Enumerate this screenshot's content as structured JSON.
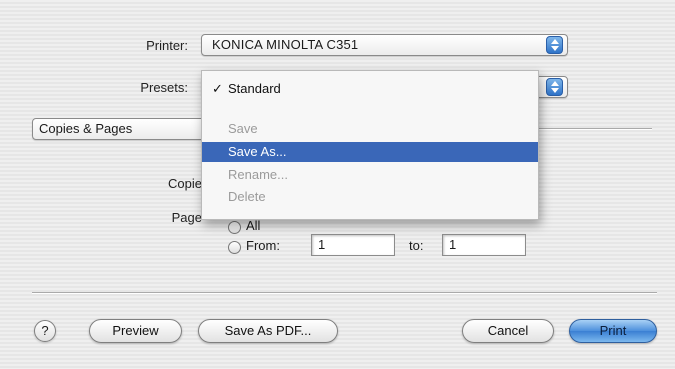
{
  "printer": {
    "label": "Printer:",
    "value": "KONICA MINOLTA C351"
  },
  "presets": {
    "label": "Presets:"
  },
  "section_popup": {
    "value": "Copies & Pages"
  },
  "presets_menu": {
    "items": [
      {
        "label": "Standard",
        "checked": true,
        "state": "normal"
      },
      {
        "label": "Save",
        "state": "disabled"
      },
      {
        "label": "Save As...",
        "state": "selected"
      },
      {
        "label": "Rename...",
        "state": "disabled"
      },
      {
        "label": "Delete",
        "state": "disabled"
      }
    ],
    "check_glyph": "✓"
  },
  "copies": {
    "label": "Copie"
  },
  "pages": {
    "label": "Page",
    "all_label": "All",
    "from_label": "From:",
    "from_value": "1",
    "to_label": "to:",
    "to_value": "1"
  },
  "footer": {
    "help_glyph": "?",
    "preview_label": "Preview",
    "save_pdf_label": "Save As PDF...",
    "cancel_label": "Cancel",
    "print_label": "Print"
  },
  "colors": {
    "selection": "#3a67b8",
    "default_button": "#4c8fdc"
  }
}
